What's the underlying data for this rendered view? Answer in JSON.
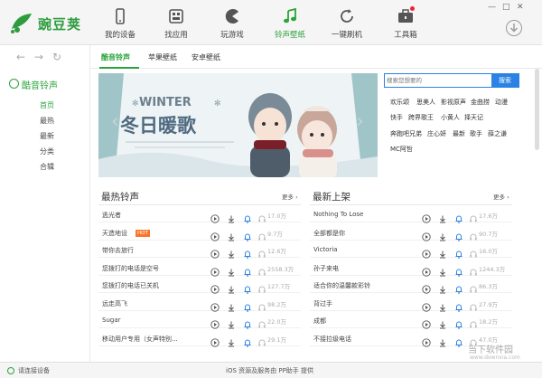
{
  "app": {
    "name": "豌豆荚"
  },
  "nav": [
    {
      "label": "我的设备",
      "icon": "phone-icon"
    },
    {
      "label": "找应用",
      "icon": "app-grid-icon"
    },
    {
      "label": "玩游戏",
      "icon": "pacman-icon"
    },
    {
      "label": "铃声壁纸",
      "icon": "music-note-icon",
      "active": true
    },
    {
      "label": "一键刷机",
      "icon": "refresh-icon"
    },
    {
      "label": "工具箱",
      "icon": "toolbox-icon"
    }
  ],
  "sidebar": {
    "title": "酷音铃声",
    "items": [
      "首页",
      "最热",
      "最新",
      "分类",
      "合辑"
    ]
  },
  "subtabs": [
    "酷音铃声",
    "苹果壁纸",
    "安卓壁纸"
  ],
  "banner": {
    "title_en": "WINTER",
    "title_cn": "冬日暖歌"
  },
  "search": {
    "placeholder": "搜索您想要的",
    "button": "搜索"
  },
  "tags": [
    "欢乐颂",
    "思美人",
    "影视原声",
    "金曲捞",
    "动漫",
    "快手",
    "跨界歌王",
    "小黄人",
    "择天记",
    "奔跑吧兄弟",
    "庄心妍",
    "最新",
    "歌手",
    "薛之谦",
    "MC阿哲"
  ],
  "hot_list": {
    "title": "最热铃声",
    "more": "更多",
    "rows": [
      {
        "name": "逃光者",
        "count": "17.0万"
      },
      {
        "name": "天造地设",
        "count": "9.7万",
        "hot": "HOT"
      },
      {
        "name": "带你去旅行",
        "count": "12.6万"
      },
      {
        "name": "您拨打的电话是空号",
        "count": "2558.3万"
      },
      {
        "name": "您拨打的电话已关机",
        "count": "127.7万"
      },
      {
        "name": "远走高飞",
        "count": "98.2万"
      },
      {
        "name": "Sugar",
        "count": "22.0万"
      },
      {
        "name": "移动用户专用（女声特别...",
        "count": "29.1万"
      }
    ]
  },
  "new_list": {
    "title": "最新上架",
    "more": "更多",
    "rows": [
      {
        "name": "Nothing To Lose",
        "count": "17.6万"
      },
      {
        "name": "全部都是你",
        "count": "90.7万"
      },
      {
        "name": "Victoria",
        "count": "16.0万"
      },
      {
        "name": "孙子来电",
        "count": "1244.3万"
      },
      {
        "name": "适合你的温馨款彩铃",
        "count": "86.3万"
      },
      {
        "name": "背过手",
        "count": "27.9万"
      },
      {
        "name": "成都",
        "count": "18.2万"
      },
      {
        "name": "不接拉级电话",
        "count": "47.0万"
      }
    ]
  },
  "status": {
    "left": "请连接设备",
    "mid": "iOS 资源及服务由 PP助手 提供"
  },
  "watermark": {
    "main": "当下软件园",
    "sub": "www.downxia.com"
  },
  "colors": {
    "accent": "#2aa43c",
    "search_blue": "#2a82e4",
    "hot": "#f7762b"
  }
}
